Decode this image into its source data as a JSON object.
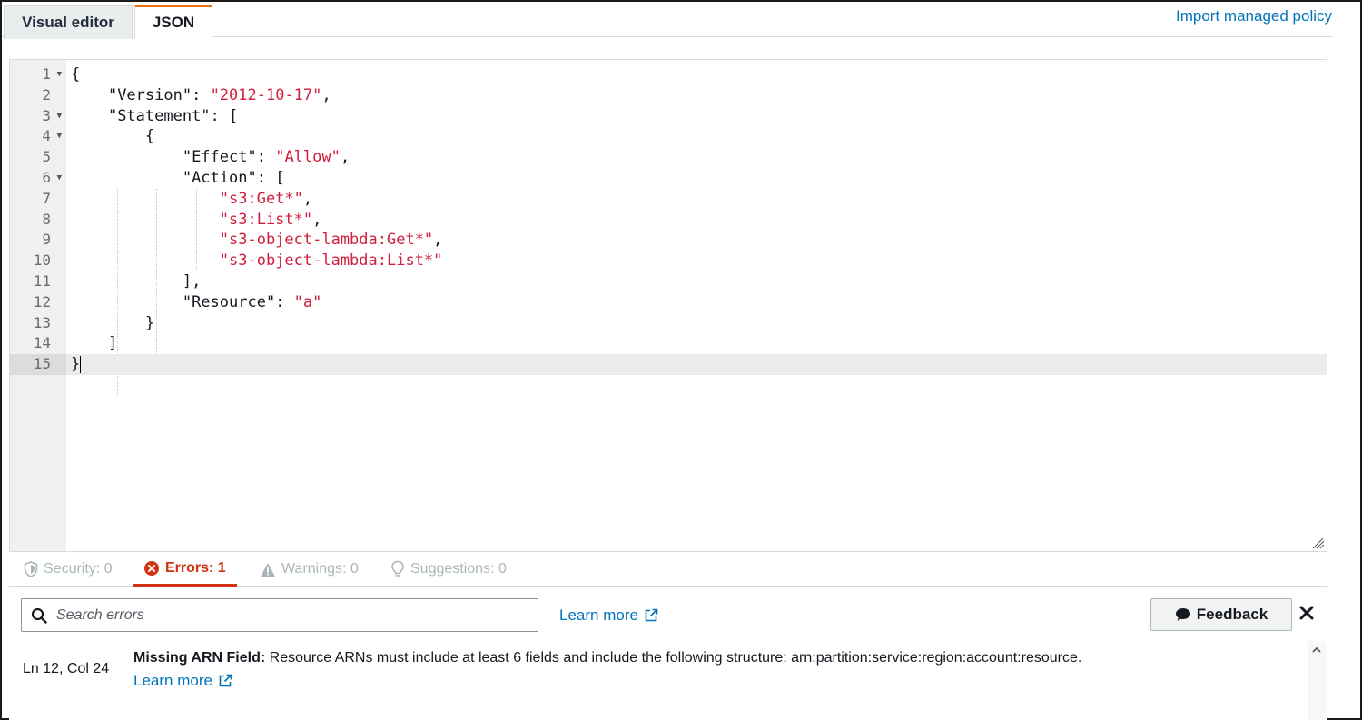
{
  "tabs": {
    "visual_editor": "Visual editor",
    "json": "JSON"
  },
  "import_link": "Import managed policy",
  "editor": {
    "line_numbers": [
      "1",
      "2",
      "3",
      "4",
      "5",
      "6",
      "7",
      "8",
      "9",
      "10",
      "11",
      "12",
      "13",
      "14",
      "15"
    ],
    "tokens": {
      "l1": "{",
      "l2_key": "\"Version\"",
      "l2_sep": ": ",
      "l2_val": "\"2012-10-17\"",
      "l2_end": ",",
      "l3_key": "\"Statement\"",
      "l3_end": ": [",
      "l4": "{",
      "l5_key": "\"Effect\"",
      "l5_sep": ": ",
      "l5_val": "\"Allow\"",
      "l5_end": ",",
      "l6_key": "\"Action\"",
      "l6_end": ": [",
      "l7_val": "\"s3:Get*\"",
      "l7_end": ",",
      "l8_val": "\"s3:List*\"",
      "l8_end": ",",
      "l9_val": "\"s3-object-lambda:Get*\"",
      "l9_end": ",",
      "l10_val": "\"s3-object-lambda:List*\"",
      "l11": "],",
      "l12_key": "\"Resource\"",
      "l12_sep": ": ",
      "l12_val": "\"a\"",
      "l13": "}",
      "l14": "]",
      "l15": "}"
    },
    "active_line": 15
  },
  "status_tabs": {
    "security": "Security: 0",
    "errors": "Errors: 1",
    "warnings": "Warnings: 0",
    "suggestions": "Suggestions: 0"
  },
  "panel": {
    "search_placeholder": "Search errors",
    "learn_more": "Learn more",
    "feedback": "Feedback",
    "error": {
      "location": "Ln 12, Col 24",
      "title": "Missing ARN Field:",
      "text": " Resource ARNs must include at least 6 fields and include the following structure: arn:partition:service:region:account:resource.",
      "learn_more": "Learn more"
    }
  },
  "colors": {
    "accent_tab": "#ec7211",
    "link": "#0073bb",
    "error": "#d13212",
    "string": "#d01f3c"
  }
}
